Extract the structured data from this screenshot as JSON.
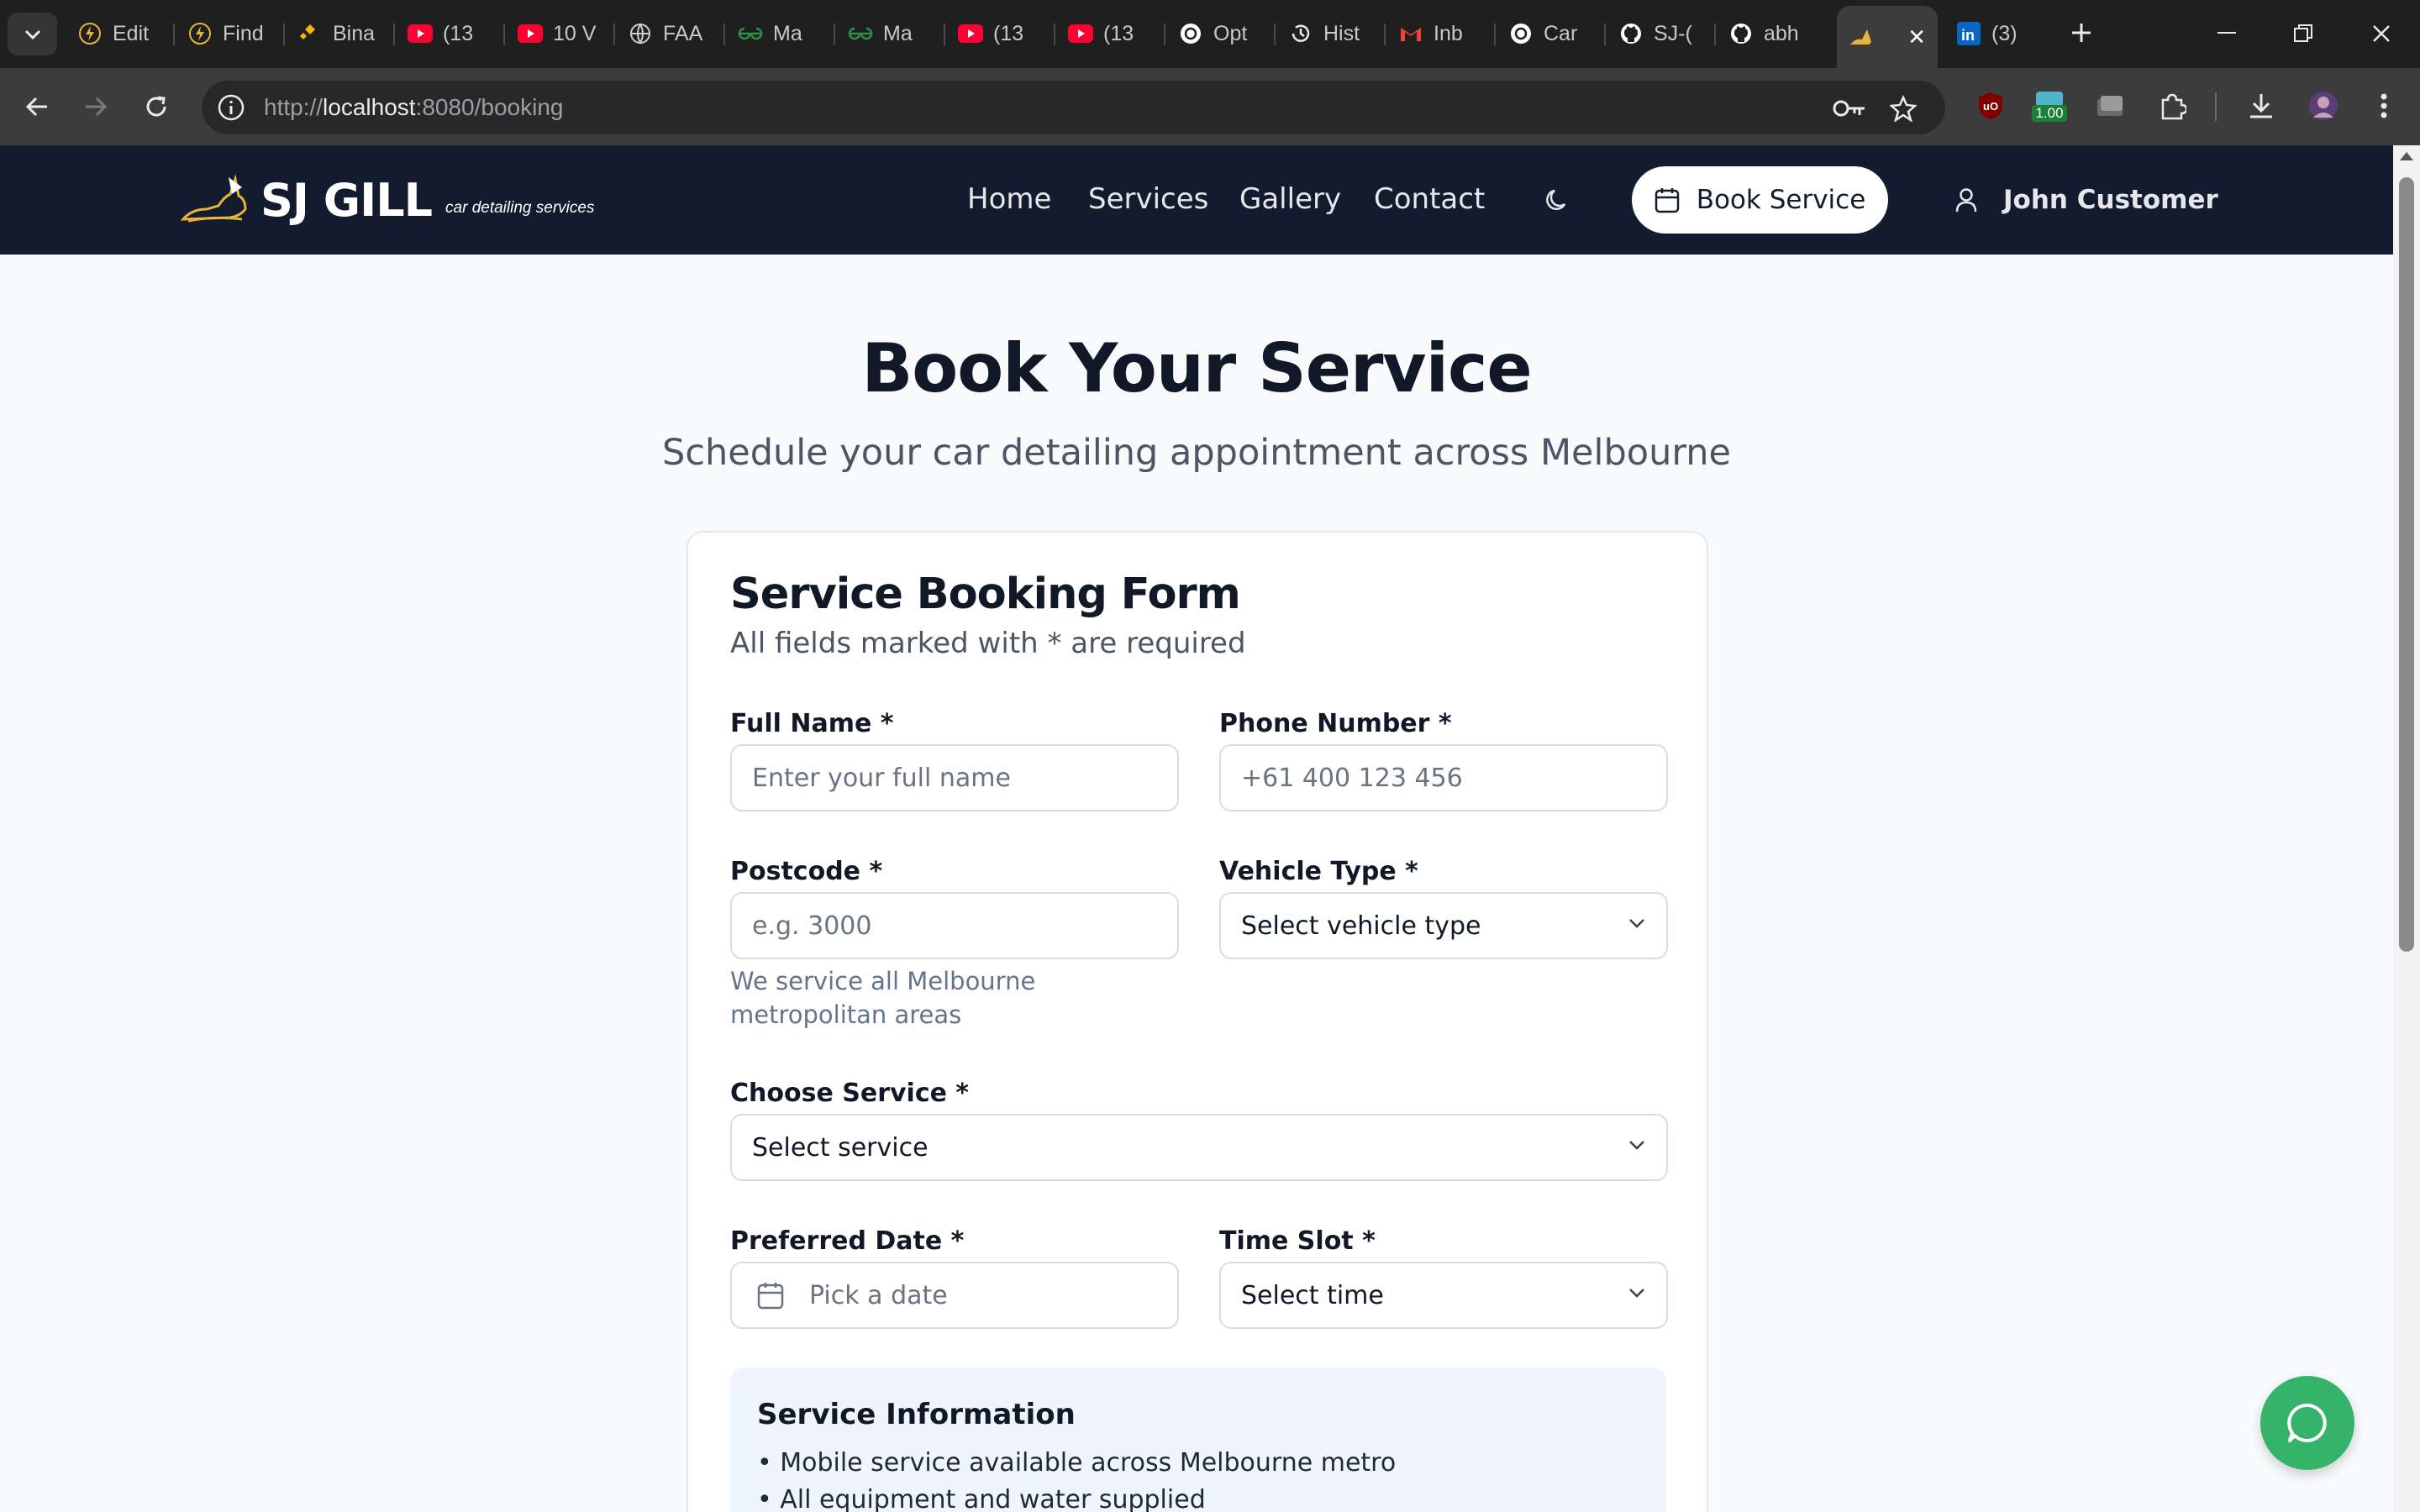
{
  "browser": {
    "tabs": [
      {
        "label": "Edit",
        "icon": "bolt-favicon"
      },
      {
        "label": "Find",
        "icon": "bolt-favicon"
      },
      {
        "label": "Bina",
        "icon": "binance-favicon"
      },
      {
        "label": "(13",
        "icon": "youtube-favicon"
      },
      {
        "label": "10 V",
        "icon": "youtube-favicon"
      },
      {
        "label": "FAA",
        "icon": "globe-favicon"
      },
      {
        "label": "Ma",
        "icon": "geeksforgeeks-favicon"
      },
      {
        "label": "Ma",
        "icon": "geeksforgeeks-favicon"
      },
      {
        "label": "(13",
        "icon": "youtube-favicon"
      },
      {
        "label": "(13",
        "icon": "youtube-favicon"
      },
      {
        "label": "Opt",
        "icon": "openai-favicon"
      },
      {
        "label": "Hist",
        "icon": "history-favicon"
      },
      {
        "label": "Inb",
        "icon": "gmail-favicon"
      },
      {
        "label": "Car",
        "icon": "openai-favicon"
      },
      {
        "label": "SJ-(",
        "icon": "github-favicon"
      },
      {
        "label": "abh",
        "icon": "github-favicon"
      }
    ],
    "active_tab": {
      "label": "",
      "icon": "sj-gill-favicon"
    },
    "last_tab": {
      "label": "(3)",
      "icon": "linkedin-favicon"
    },
    "url_prefix": "http://",
    "url_host": "localhost",
    "url_path": ":8080/booking",
    "extension_badge": "1.00"
  },
  "site": {
    "logo_text": "SJ GILL",
    "logo_tagline": "car detailing services",
    "nav": {
      "home": "Home",
      "services": "Services",
      "gallery": "Gallery",
      "contact": "Contact"
    },
    "book_button": "Book Service",
    "user_name": "John Customer"
  },
  "page": {
    "title": "Book Your Service",
    "subtitle": "Schedule your car detailing appointment across Melbourne"
  },
  "form": {
    "title": "Service Booking Form",
    "description": "All fields marked with * are required",
    "full_name": {
      "label": "Full Name *",
      "placeholder": "Enter your full name",
      "value": ""
    },
    "phone": {
      "label": "Phone Number *",
      "placeholder": "+61 400 123 456",
      "value": ""
    },
    "postcode": {
      "label": "Postcode *",
      "placeholder": "e.g. 3000",
      "value": "",
      "hint": "We service all Melbourne metropolitan areas"
    },
    "vehicle_type": {
      "label": "Vehicle Type *",
      "value": "Select vehicle type"
    },
    "service": {
      "label": "Choose Service *",
      "value": "Select service"
    },
    "date": {
      "label": "Preferred Date *",
      "value": "Pick a date"
    },
    "time_slot": {
      "label": "Time Slot *",
      "value": "Select time"
    }
  },
  "service_info": {
    "title": "Service Information",
    "lines": [
      "• Mobile service available across Melbourne metro",
      "• All equipment and water supplied"
    ]
  },
  "colors": {
    "header_bg": "#131b2e",
    "page_bg": "#f8fafc",
    "info_bg": "#eef5fd",
    "chat_button": "#35b36b",
    "logo_accent": "#e8b33a"
  }
}
